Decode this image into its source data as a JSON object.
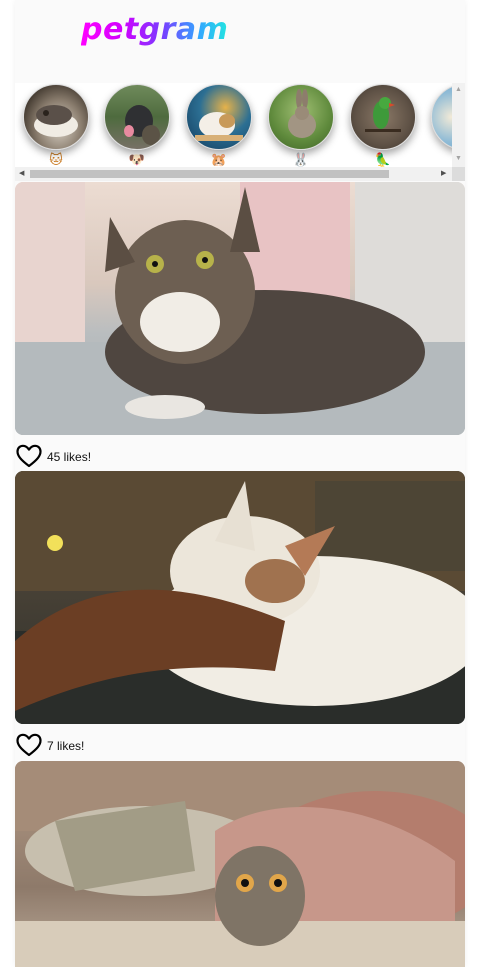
{
  "app": {
    "logo": "petgram",
    "colors": {
      "logo_gradient": [
        "#ff00ff",
        "#7a3cff",
        "#22e5e0"
      ],
      "heart_stroke": "#000000"
    }
  },
  "categories": [
    {
      "emoji": "🐱",
      "icon": "cat-face-icon"
    },
    {
      "emoji": "🐶",
      "icon": "dog-face-icon"
    },
    {
      "emoji": "🐹",
      "icon": "hamster-face-icon"
    },
    {
      "emoji": "🐰",
      "icon": "rabbit-face-icon"
    },
    {
      "emoji": "🦜",
      "icon": "parrot-icon"
    },
    {
      "emoji": "",
      "icon": "category-icon"
    }
  ],
  "posts": [
    {
      "likes_text": "45 likes!",
      "likes": 45
    },
    {
      "likes_text": "7 likes!",
      "likes": 7
    },
    {
      "likes_text": "",
      "likes": null
    }
  ]
}
